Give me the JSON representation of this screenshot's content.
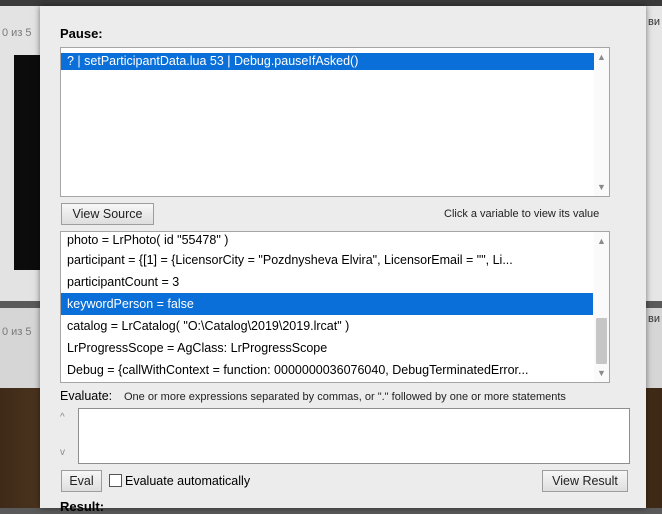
{
  "background": {
    "count_top": "0 из 5",
    "count_bottom": "0 из 5",
    "right_text_top": "ви",
    "right_text_bottom": "ви"
  },
  "dialog": {
    "pause_label": "Pause:",
    "stack_frames": [
      "? | setParticipantData.lua 53 | Debug.pauseIfAsked()"
    ],
    "view_source_label": "View Source",
    "variables_hint": "Click a variable to view its value",
    "variables": [
      "photo = LrPhoto( id \"55478\" )",
      "participant = {[1] = {LicensorCity = \"Pozdnysheva Elvira\", LicensorEmail = \"\", Li...",
      "participantCount = 3",
      "keywordPerson = false",
      "catalog = LrCatalog( \"O:\\Catalog\\2019\\2019.lrcat\" )",
      "LrProgressScope = AgClass: LrProgressScope",
      "Debug = {callWithContext = function: 0000000036076040, DebugTerminatedError..."
    ],
    "selected_variable_index": 3,
    "evaluate_label": "Evaluate:",
    "evaluate_hint": "One or more expressions separated by commas, or \".\" followed by one or more statements",
    "evaluate_value": "",
    "eval_button_label": "Eval",
    "evaluate_automatically_label": "Evaluate automatically",
    "evaluate_automatically_checked": false,
    "view_result_label": "View Result",
    "result_label": "Result:"
  },
  "colors": {
    "selection": "#0a6fd8",
    "dialog_bg": "#ececec"
  }
}
